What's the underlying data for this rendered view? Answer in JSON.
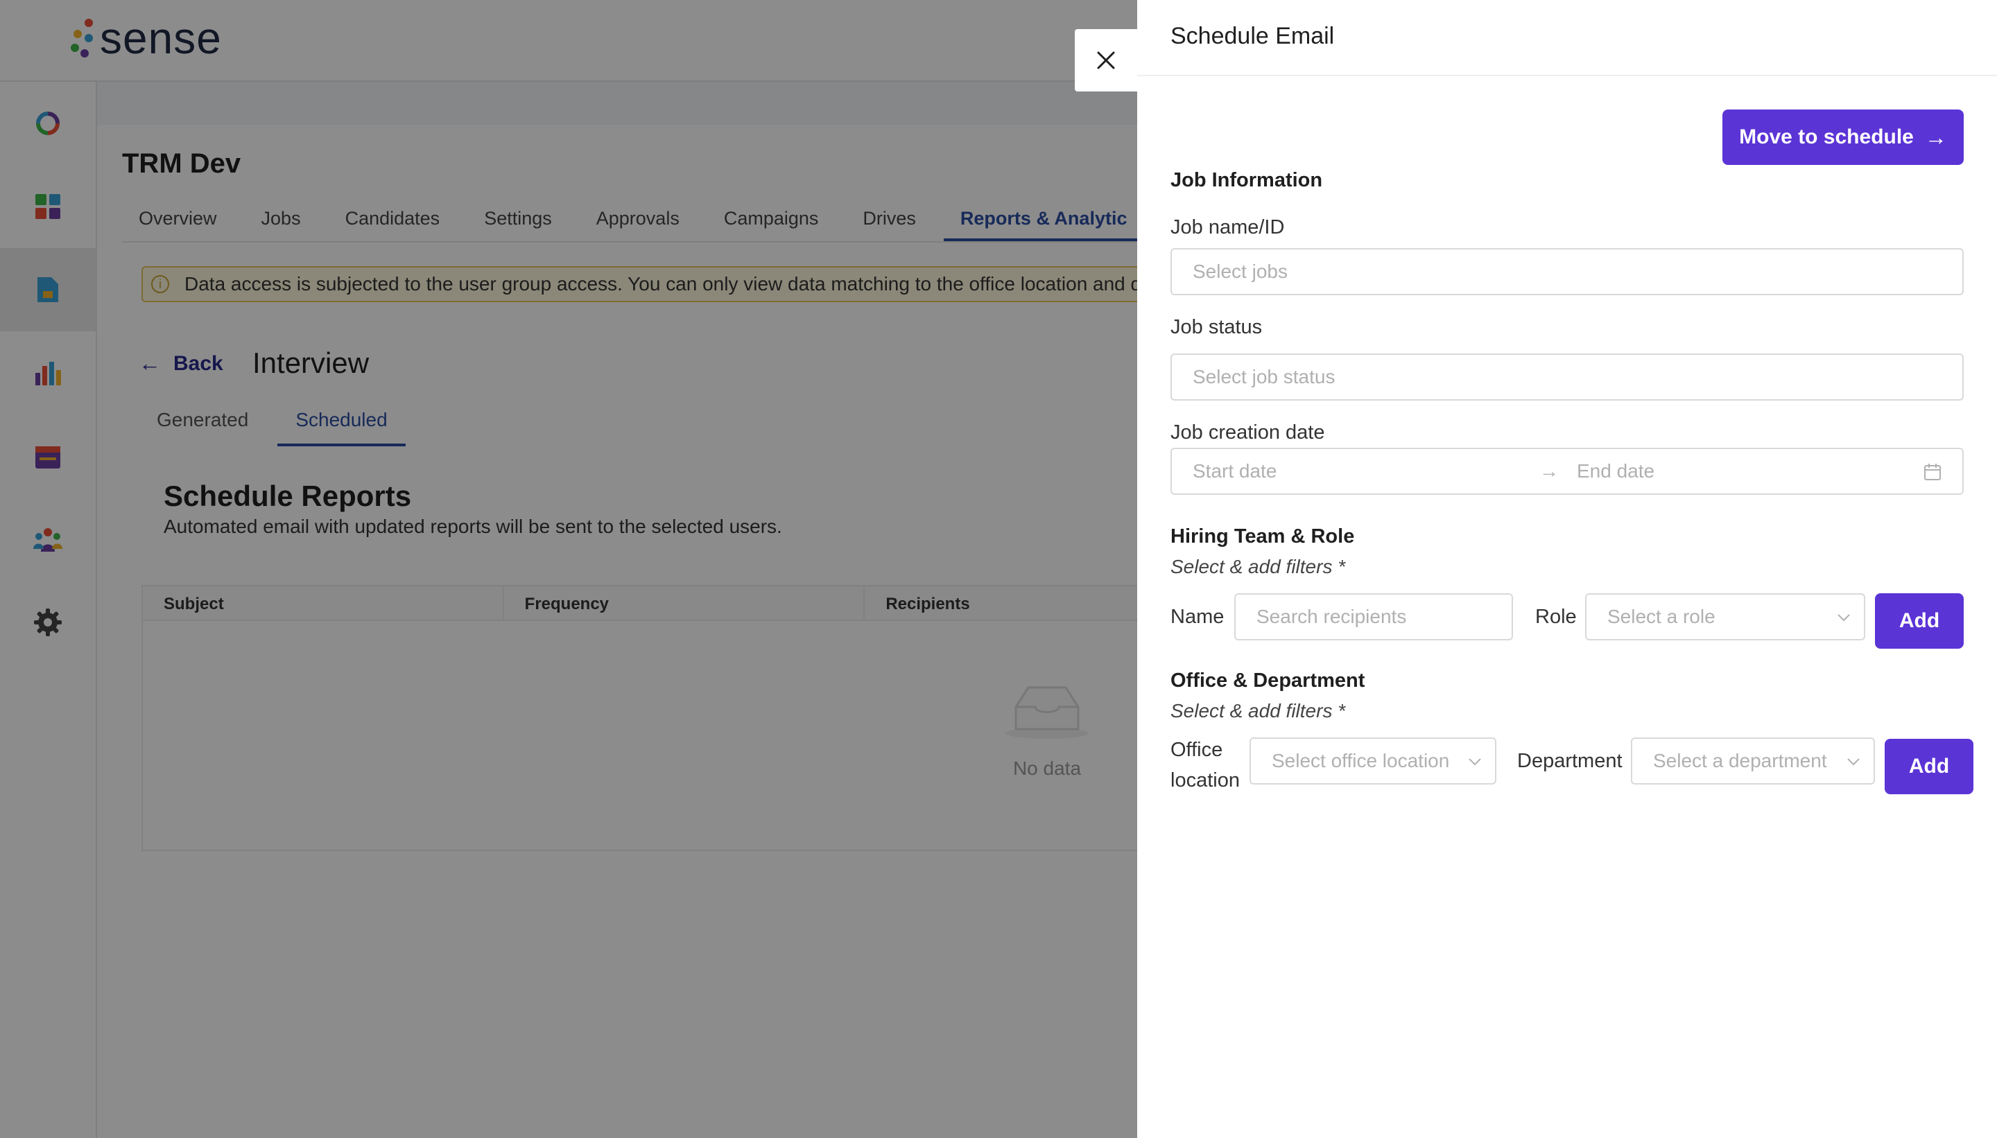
{
  "app": {
    "logo_text": "sense",
    "project_title": "TRM Dev",
    "nav_tabs": [
      {
        "label": "Overview"
      },
      {
        "label": "Jobs"
      },
      {
        "label": "Candidates"
      },
      {
        "label": "Settings"
      },
      {
        "label": "Approvals"
      },
      {
        "label": "Campaigns"
      },
      {
        "label": "Drives"
      },
      {
        "label": "Reports & Analytic"
      }
    ],
    "alert_text": "Data access is subjected to the user group access. You can only view data matching to the office location and de",
    "back_label": "Back",
    "page_title": "Interview",
    "sub_tabs": [
      {
        "label": "Generated"
      },
      {
        "label": "Scheduled"
      }
    ],
    "schedule_title": "Schedule Reports",
    "schedule_subtitle": "Automated email with updated reports will be sent to the selected users.",
    "table_headers": [
      "Subject",
      "Frequency",
      "Recipients"
    ],
    "empty_text": "No data",
    "sidebar_icons": [
      "sense-ring-icon",
      "dashboard-grid-icon",
      "document-icon",
      "bar-chart-icon",
      "calendar-icon",
      "team-icon",
      "gear-icon"
    ]
  },
  "drawer": {
    "title": "Schedule Email",
    "move_button": "Move to schedule",
    "job_info": {
      "section_title": "Job Information",
      "job_name_label": "Job name/ID",
      "job_name_placeholder": "Select jobs",
      "job_status_label": "Job status",
      "job_status_placeholder": "Select job status",
      "creation_date_label": "Job creation date",
      "start_date_placeholder": "Start date",
      "end_date_placeholder": "End date"
    },
    "hiring": {
      "section_title": "Hiring Team & Role",
      "hint": "Select & add filters *",
      "name_label": "Name",
      "name_placeholder": "Search recipients",
      "role_label": "Role",
      "role_placeholder": "Select a role",
      "add_label": "Add"
    },
    "office": {
      "section_title": "Office & Department",
      "hint": "Select & add filters *",
      "office_label_line1": "Office",
      "office_label_line2": "location",
      "office_placeholder": "Select office location",
      "department_label": "Department",
      "department_placeholder": "Select a department",
      "add_label": "Add"
    }
  },
  "colors": {
    "primary": "#5b34d6",
    "link_blue": "#2b4ea2",
    "overlay": "rgba(0,0,0,0.45)"
  }
}
